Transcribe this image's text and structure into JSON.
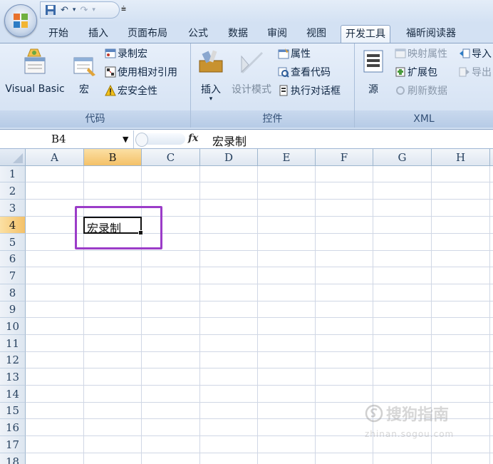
{
  "tabs": [
    "开始",
    "插入",
    "页面布局",
    "公式",
    "数据",
    "审阅",
    "视图",
    "开发工具",
    "福昕阅读器"
  ],
  "active_tab": "开发工具",
  "ribbon": {
    "code": {
      "label": "代码",
      "visual_basic": "Visual Basic",
      "macros": "宏",
      "record_macro": "录制宏",
      "relative_ref": "使用相对引用",
      "macro_security": "宏安全性"
    },
    "controls": {
      "label": "控件",
      "insert": "插入",
      "design_mode": "设计模式",
      "properties": "属性",
      "view_code": "查看代码",
      "run_dialog": "执行对话框"
    },
    "xml": {
      "label": "XML",
      "source": "源",
      "map_properties": "映射属性",
      "expansion_packs": "扩展包",
      "refresh_data": "刷新数据",
      "import": "导入",
      "export": "导出"
    }
  },
  "formula_bar": {
    "name_box": "B4",
    "fx": "fx",
    "formula": "宏录制"
  },
  "sheet": {
    "columns": [
      "A",
      "B",
      "C",
      "D",
      "E",
      "F",
      "G",
      "H"
    ],
    "rows": [
      "1",
      "2",
      "3",
      "4",
      "5",
      "6",
      "7",
      "8",
      "9",
      "10",
      "11",
      "12",
      "13",
      "14",
      "15",
      "16",
      "17",
      "18"
    ],
    "selected_column": "B",
    "selected_row": "4",
    "cell_b4": "宏录制"
  },
  "watermark": {
    "title": "搜狗指南",
    "url": "zhinan.sogou.com"
  },
  "colors": {
    "annotation": "#9b3cc8",
    "selected_header": "#f4c168"
  }
}
